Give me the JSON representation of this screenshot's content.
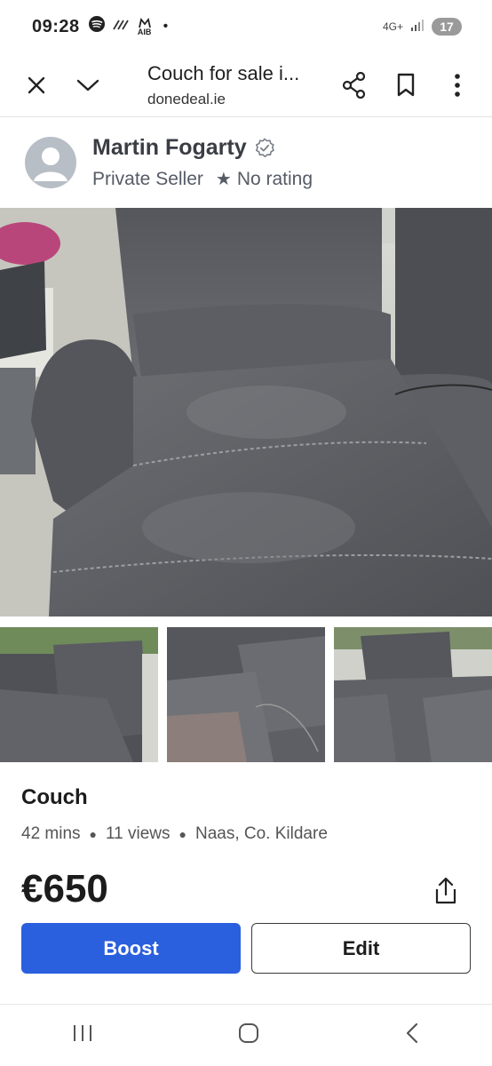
{
  "status_bar": {
    "time": "09:28",
    "network": "4G+",
    "battery": "17",
    "left_icons": [
      "spotify-icon",
      "wifi-calling-icon",
      "aib-icon",
      "dot-icon"
    ],
    "aib_label": "AIB"
  },
  "browser": {
    "title": "Couch for sale i...",
    "domain": "donedeal.ie"
  },
  "seller": {
    "name": "Martin Fogarty",
    "type": "Private Seller",
    "rating": "No rating"
  },
  "listing": {
    "title": "Couch",
    "posted": "42 mins",
    "views": "11 views",
    "location": "Naas, Co. Kildare",
    "price": "€650"
  },
  "actions": {
    "boost_label": "Boost",
    "edit_label": "Edit"
  },
  "colors": {
    "accent": "#2a5fde",
    "seller_name": "#3a3d44",
    "text_muted": "#555b66"
  },
  "photos": {
    "count_thumbnails": 3
  }
}
